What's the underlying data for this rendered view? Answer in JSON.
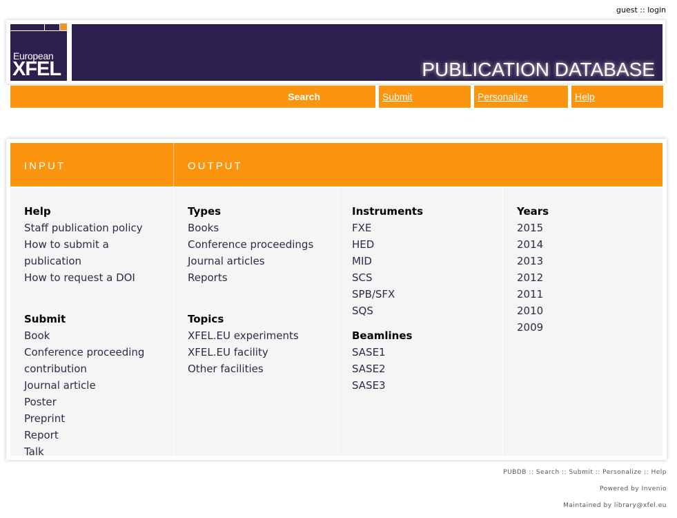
{
  "user": {
    "guest": "guest",
    "separator": "::",
    "login": "login"
  },
  "header": {
    "logo_line1": "European",
    "logo_line2": "XFEL",
    "title": "PUBLICATION DATABASE"
  },
  "nav": {
    "search": "Search",
    "submit": "Submit",
    "personalize": "Personalize",
    "help": "Help"
  },
  "panel": {
    "input_label": "INPUT",
    "output_label": "OUTPUT",
    "help": {
      "heading": "Help",
      "items": [
        "Staff publication policy",
        "How to submit a publication",
        "How to request a DOI"
      ]
    },
    "submit": {
      "heading": "Submit",
      "items": [
        "Book",
        "Conference proceeding",
        "contribution",
        "Journal article",
        "Poster",
        "Preprint",
        "Report",
        "Talk"
      ]
    },
    "types": {
      "heading": "Types",
      "items": [
        "Books",
        "Conference proceedings",
        "Journal articles",
        "Reports"
      ]
    },
    "topics": {
      "heading": "Topics",
      "items": [
        "XFEL.EU experiments",
        "XFEL.EU facility",
        "Other facilities"
      ]
    },
    "instruments": {
      "heading": "Instruments",
      "items": [
        "FXE",
        "HED",
        "MID",
        "SCS",
        "SPB/SFX",
        "SQS"
      ]
    },
    "beamlines": {
      "heading": "Beamlines",
      "items": [
        "SASE1",
        "SASE2",
        "SASE3"
      ]
    },
    "years": {
      "heading": "Years",
      "items": [
        "2015",
        "2014",
        "2013",
        "2012",
        "2011",
        "2010",
        "2009"
      ]
    }
  },
  "footer": {
    "links": "PUBDB :: Search :: Submit :: Personalize :: Help",
    "powered": "Powered by Invenio",
    "maintained": "Maintained by library@xfel.eu"
  },
  "colors": {
    "orange": "#fb940f",
    "purple": "#2d1f4e",
    "panel_grey": "#f5f5f5"
  }
}
